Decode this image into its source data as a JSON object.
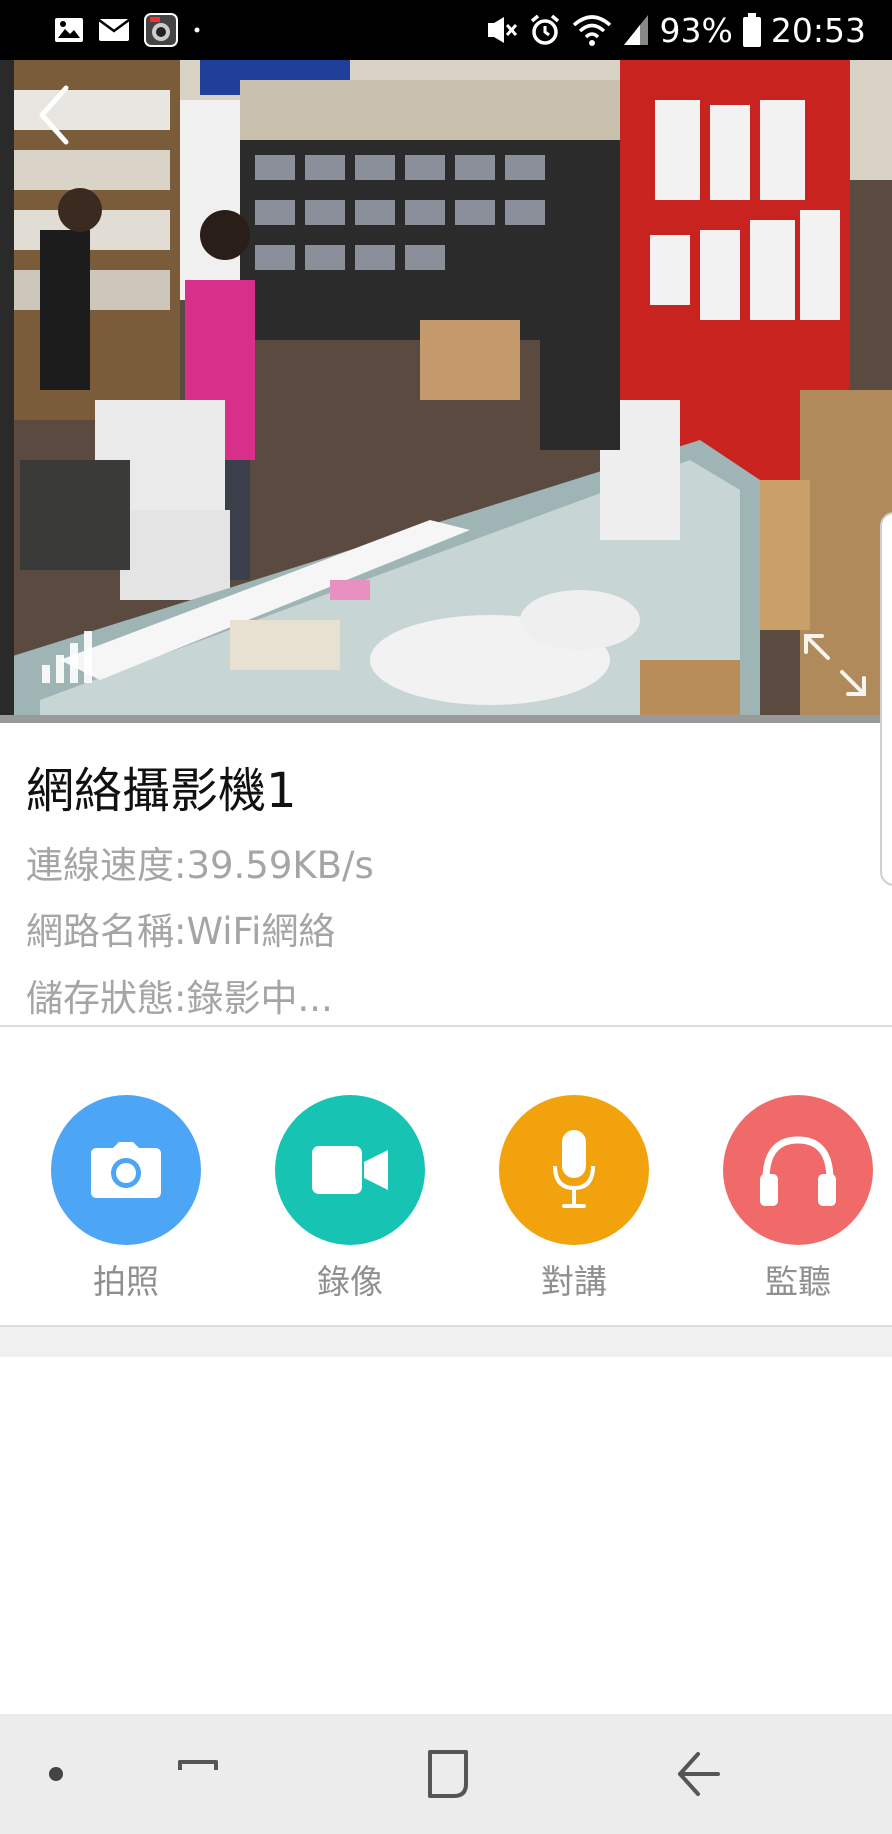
{
  "status_bar": {
    "battery": "93%",
    "time": "20:53",
    "left_icons": [
      "image-icon",
      "mail-icon",
      "app-icon",
      "dot-icon"
    ],
    "right_icons": [
      "mute-icon",
      "alarm-icon",
      "wifi-icon",
      "signal-icon",
      "battery-icon"
    ]
  },
  "camera": {
    "name": "網絡攝影機1",
    "speed": "連線速度:39.59KB/s",
    "network": "網路名稱:WiFi網絡",
    "storage": "儲存狀態:錄影中..."
  },
  "actions": [
    {
      "label": "拍照",
      "icon": "camera-icon",
      "color": "#4da6f5"
    },
    {
      "label": "錄像",
      "icon": "video-camera-icon",
      "color": "#17c3b2"
    },
    {
      "label": "對講",
      "icon": "microphone-icon",
      "color": "#f2a20c"
    },
    {
      "label": "監聽",
      "icon": "headphones-icon",
      "color": "#f06a6a"
    }
  ],
  "nav_bar": {
    "buttons": [
      "dot-button",
      "recent-apps-button",
      "home-button",
      "back-button"
    ]
  }
}
